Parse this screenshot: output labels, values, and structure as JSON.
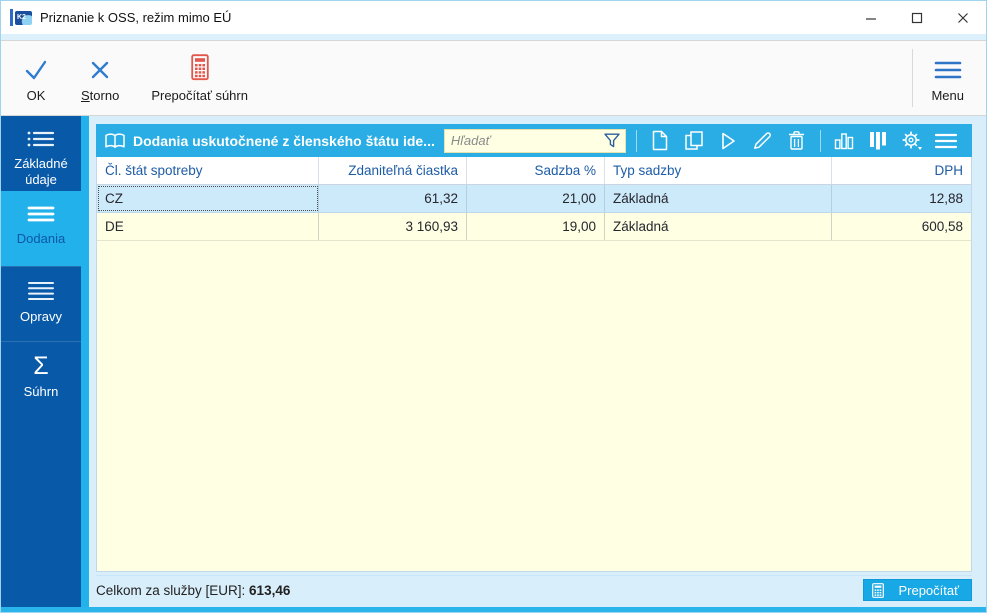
{
  "window": {
    "title": "Priznanie k OSS, režim mimo EÚ",
    "app_logo_text": "K2"
  },
  "toolbar": {
    "ok_label": "OK",
    "storno_accel": "S",
    "storno_rest": "torno",
    "recalc_summary_label": "Prepočítať súhrn",
    "menu_label": "Menu"
  },
  "sidebar": {
    "items": [
      {
        "label": "Základné údaje",
        "selected": false
      },
      {
        "label": "Dodania",
        "selected": true
      },
      {
        "label": "Opravy",
        "selected": false
      },
      {
        "label": "Súhrn",
        "selected": false
      }
    ]
  },
  "panel": {
    "title": "Dodania uskutočnené z členského štátu ide...",
    "search_placeholder": "Hľadať"
  },
  "table": {
    "columns": [
      "Čl. štát spotreby",
      "Zdaniteľná čiastka",
      "Sadzba %",
      "Typ sadzby",
      "DPH"
    ],
    "rows": [
      {
        "state": "CZ",
        "base": "61,32",
        "rate": "21,00",
        "rate_type": "Základná",
        "vat": "12,88",
        "selected": true
      },
      {
        "state": "DE",
        "base": "3 160,93",
        "rate": "19,00",
        "rate_type": "Základná",
        "vat": "600,58",
        "selected": false
      }
    ]
  },
  "footer": {
    "total_label": "Celkom za služby [EUR]: ",
    "total_value": "613,46",
    "recalc_button_label": "Prepočítať"
  },
  "colors": {
    "sidebar_blue": "#0859a8",
    "accent_cyan": "#22b1ea",
    "panel_header_cyan": "#29ade4",
    "table_cream": "#ffffe4",
    "selected_row_blue": "#cdeafa",
    "content_light_blue": "#d9eefb",
    "danger_red": "#e2574c",
    "toolbar_icon_blue": "#2f7cd0",
    "header_text_blue": "#1d5ca6"
  }
}
